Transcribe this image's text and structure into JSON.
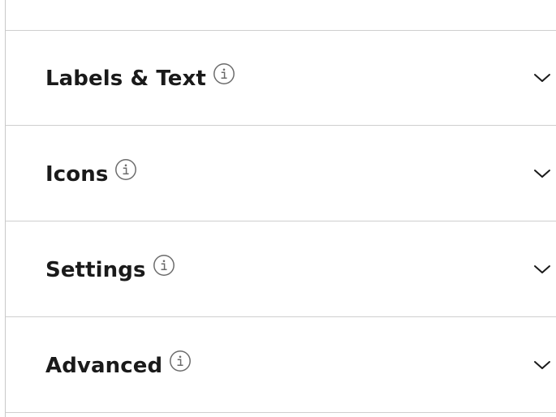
{
  "accordion": {
    "sections": [
      {
        "label": "Labels & Text",
        "info_icon": "info-icon",
        "toggle_icon": "chevron-down-icon"
      },
      {
        "label": "Icons",
        "info_icon": "info-icon",
        "toggle_icon": "chevron-down-icon"
      },
      {
        "label": "Settings",
        "info_icon": "info-icon",
        "toggle_icon": "chevron-down-icon"
      },
      {
        "label": "Advanced",
        "info_icon": "info-icon",
        "toggle_icon": "chevron-down-icon"
      }
    ]
  },
  "colors": {
    "text": "#1a1a1a",
    "divider": "#cfcfcf",
    "icon": "#6b6b6b",
    "background": "#ffffff"
  }
}
